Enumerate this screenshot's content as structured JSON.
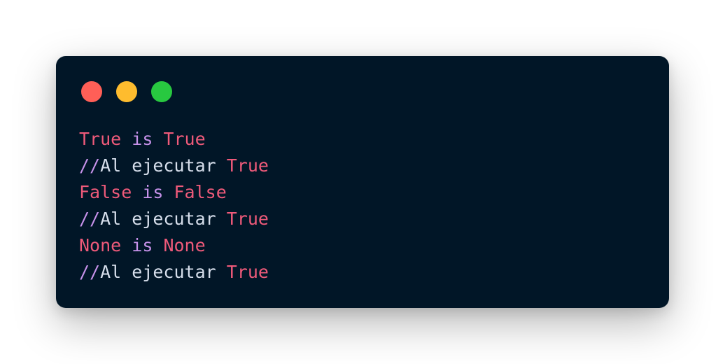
{
  "window_controls": [
    {
      "name": "close",
      "color": "#ff5f57"
    },
    {
      "name": "minimize",
      "color": "#febc2e"
    },
    {
      "name": "maximize",
      "color": "#28c840"
    }
  ],
  "colors": {
    "background": "#011627",
    "constant": "#ef5a7a",
    "keyword": "#c792ea",
    "text": "#d6deeb"
  },
  "code_lines": [
    [
      {
        "text": "True",
        "kind": "constant"
      },
      {
        "text": " ",
        "kind": "text"
      },
      {
        "text": "is",
        "kind": "keyword"
      },
      {
        "text": " ",
        "kind": "text"
      },
      {
        "text": "True",
        "kind": "constant"
      }
    ],
    [
      {
        "text": "//",
        "kind": "keyword"
      },
      {
        "text": "Al ejecutar ",
        "kind": "text"
      },
      {
        "text": "True",
        "kind": "constant"
      }
    ],
    [
      {
        "text": "False",
        "kind": "constant"
      },
      {
        "text": " ",
        "kind": "text"
      },
      {
        "text": "is",
        "kind": "keyword"
      },
      {
        "text": " ",
        "kind": "text"
      },
      {
        "text": "False",
        "kind": "constant"
      }
    ],
    [
      {
        "text": "//",
        "kind": "keyword"
      },
      {
        "text": "Al ejecutar ",
        "kind": "text"
      },
      {
        "text": "True",
        "kind": "constant"
      }
    ],
    [
      {
        "text": "None",
        "kind": "constant"
      },
      {
        "text": " ",
        "kind": "text"
      },
      {
        "text": "is",
        "kind": "keyword"
      },
      {
        "text": " ",
        "kind": "text"
      },
      {
        "text": "None",
        "kind": "constant"
      }
    ],
    [
      {
        "text": "//",
        "kind": "keyword"
      },
      {
        "text": "Al ejecutar ",
        "kind": "text"
      },
      {
        "text": "True",
        "kind": "constant"
      }
    ]
  ]
}
